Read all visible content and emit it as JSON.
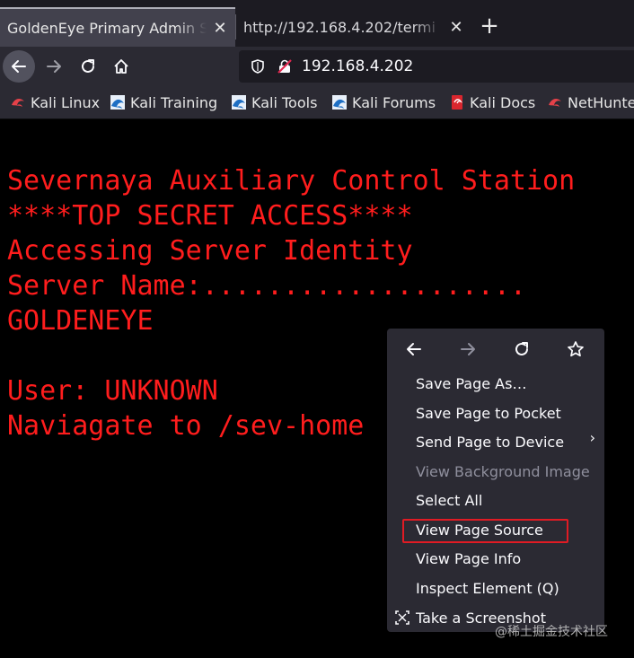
{
  "tabs": [
    {
      "label": "GoldenEye Primary Admin S",
      "active": true
    },
    {
      "label": "http://192.168.4.202/termi",
      "active": false
    }
  ],
  "toolbar": {
    "url": "192.168.4.202",
    "icons": [
      "back-icon",
      "forward-icon",
      "reload-icon",
      "home-icon",
      "shield-icon",
      "insecure-lock-icon"
    ]
  },
  "bookmarks": [
    {
      "label": "Kali Linux",
      "icon": "kali-dragon-icon"
    },
    {
      "label": "Kali Training",
      "icon": "kali-icon"
    },
    {
      "label": "Kali Tools",
      "icon": "kali-icon"
    },
    {
      "label": "Kali Forums",
      "icon": "kali-icon"
    },
    {
      "label": "Kali Docs",
      "icon": "kali-docs-icon"
    },
    {
      "label": "NetHunte",
      "icon": "kali-dragon-icon"
    }
  ],
  "terminal": {
    "lines": [
      "Severnaya Auxiliary Control Station",
      "****TOP SECRET ACCESS****",
      "Accessing Server Identity",
      "Server Name:....................",
      "GOLDENEYE",
      "",
      "User: UNKNOWN",
      "Naviagate to /sev-home"
    ],
    "color": "#ff1d1d"
  },
  "context_menu": {
    "nav_icons": [
      "back-icon",
      "forward-icon",
      "reload-icon",
      "bookmark-star-icon"
    ],
    "items": [
      {
        "label": "Save Page As…",
        "disabled": false
      },
      {
        "label": "Save Page to Pocket",
        "disabled": false
      },
      {
        "label": "Send Page to Device",
        "disabled": false,
        "submenu": true
      },
      {
        "label": "View Background Image",
        "disabled": true
      },
      {
        "label": "Select All",
        "disabled": false
      },
      {
        "label": "View Page Source",
        "disabled": false,
        "highlighted": true
      },
      {
        "label": "View Page Info",
        "disabled": false
      },
      {
        "label": "Inspect Element (Q)",
        "disabled": false
      },
      {
        "label": "Take a Screenshot",
        "disabled": false
      }
    ],
    "highlight_color": "#e01b24"
  },
  "watermark": "@稀土掘金技术社区"
}
